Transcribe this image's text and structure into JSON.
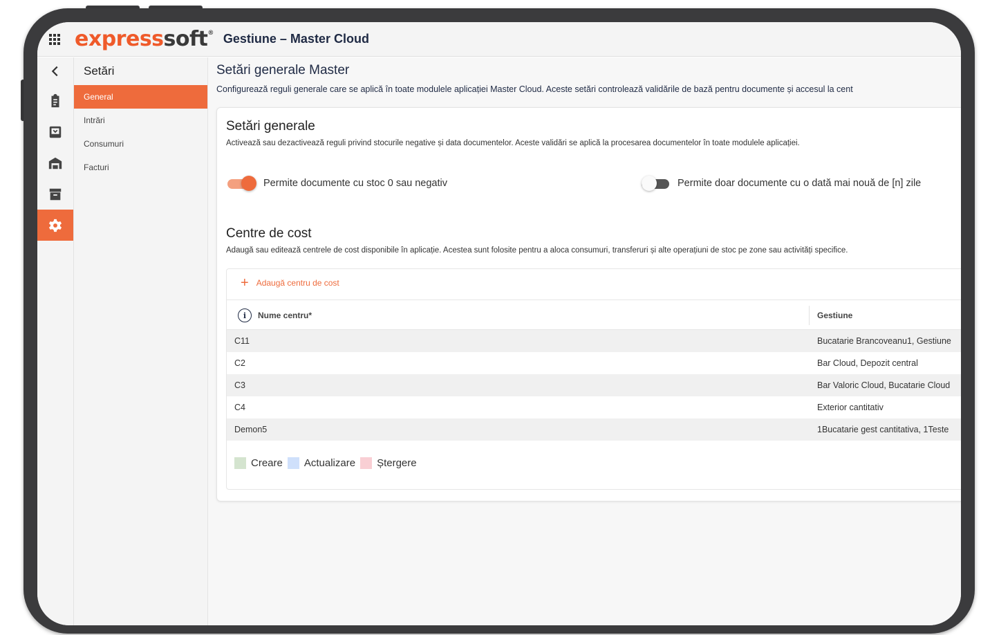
{
  "app": {
    "logo_part1": "express",
    "logo_part2": "soft",
    "logo_mark": "®",
    "title": "Gestiune – Master Cloud"
  },
  "rail": {
    "back_icon": "chevron-left-icon",
    "items": [
      {
        "icon": "clipboard-icon"
      },
      {
        "icon": "download-box-icon"
      },
      {
        "icon": "warehouse-icon"
      },
      {
        "icon": "archive-icon"
      },
      {
        "icon": "gear-icon",
        "active": true
      }
    ]
  },
  "subnav": {
    "title": "Setări",
    "items": [
      {
        "label": "General",
        "active": true
      },
      {
        "label": "Intrări"
      },
      {
        "label": "Consumuri"
      },
      {
        "label": "Facturi"
      }
    ]
  },
  "main": {
    "title": "Setări generale Master",
    "description": "Configurează reguli generale care se aplică în toate modulele aplicației Master Cloud. Aceste setări controlează validările de bază pentru documente și accesul la cent"
  },
  "general": {
    "title": "Setări generale",
    "description": "Activează sau dezactivează reguli privind stocurile negative și data documentelor. Aceste validări se aplică la procesarea documentelor în toate modulele aplicației.",
    "toggle_negative_stock": {
      "label": "Permite documente cu stoc 0 sau negativ",
      "on": true
    },
    "toggle_recent_date": {
      "label": "Permite doar documente cu o dată mai nouă de [n] zile",
      "on": false
    }
  },
  "cost_centers": {
    "title": "Centre de cost",
    "description": "Adaugă sau editează centrele de cost disponibile în aplicație. Acestea sunt folosite pentru a aloca consumuri, transferuri și alte operațiuni de stoc pe zone sau activități specifice.",
    "add_label": "Adaugă centru de cost",
    "columns": [
      "Nume centru*",
      "Gestiune"
    ],
    "rows": [
      [
        "C11",
        "Bucatarie Brancoveanu1, Gestiune"
      ],
      [
        "C2",
        "Bar Cloud, Depozit central"
      ],
      [
        "C3",
        "Bar Valoric Cloud, Bucatarie Cloud"
      ],
      [
        "C4",
        "Exterior cantitativ"
      ],
      [
        "Demon5",
        "1Bucatarie gest cantitativa, 1Teste"
      ]
    ],
    "legend": [
      {
        "label": "Creare",
        "color": "#d4e4cf"
      },
      {
        "label": "Actualizare",
        "color": "#cfe0fb"
      },
      {
        "label": "Ștergere",
        "color": "#f9cfd4"
      }
    ]
  },
  "colors": {
    "accent": "#ee6b3c",
    "nav_text": "#1f2a44"
  }
}
